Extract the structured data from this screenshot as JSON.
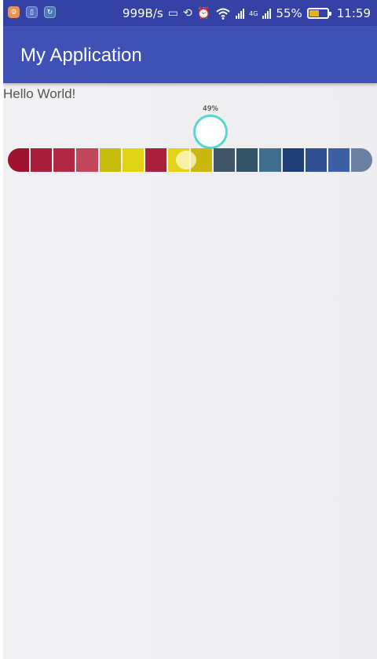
{
  "status_bar": {
    "net_speed": "999B/s",
    "battery_pct": "55%",
    "battery_level": 0.55,
    "time": "11:59",
    "network_type": "4G",
    "icons": [
      "notification-app-icon",
      "notification-shield-icon",
      "notification-refresh-icon",
      "screen-cast-icon",
      "rotation-icon",
      "alarm-icon",
      "wifi-icon",
      "signal-icon",
      "battery-icon"
    ]
  },
  "app_bar": {
    "title": "My Application"
  },
  "content": {
    "hello_text": "Hello World!",
    "seekbar": {
      "progress_label": "49%",
      "progress": 0.49,
      "segment_colors": [
        "#a0132e",
        "#a71e3b",
        "#b02843",
        "#c24659",
        "#c8bc0c",
        "#e1d414",
        "#a91f3c",
        "#e3d31a",
        "#cbb80f",
        "#405668",
        "#325468",
        "#3f6e8e",
        "#1e3d74",
        "#2f5193",
        "#3d5fa6",
        "#6c80a1"
      ]
    }
  }
}
